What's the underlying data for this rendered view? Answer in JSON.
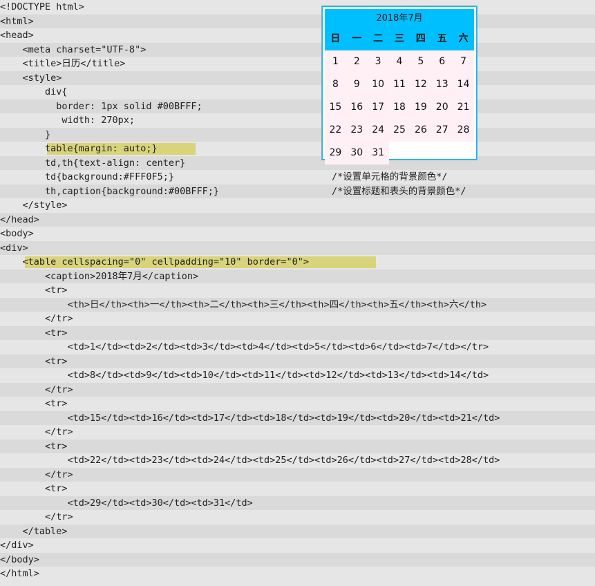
{
  "code_lines": [
    {
      "text": "<!DOCTYPE html>"
    },
    {
      "text": "<html>"
    },
    {
      "text": "<head>"
    },
    {
      "text": "    <meta charset=\"UTF-8\">"
    },
    {
      "text": "    <title>日历</title>"
    },
    {
      "text": "    <style>"
    },
    {
      "text": "        div{"
    },
    {
      "text": "          border: 1px solid #00BFFF;"
    },
    {
      "text": "           width: 270px;"
    },
    {
      "text": "        }"
    },
    {
      "text": "        table{margin: auto;}",
      "highlight": true
    },
    {
      "text": "        td,th{text-align: center}"
    },
    {
      "text": "        td{background:#FFF0F5;}",
      "comment": "/*设置单元格的背景颜色*/"
    },
    {
      "text": "        th,caption{background:#00BFFF;}",
      "comment": "/*设置标题和表头的背景颜色*/"
    },
    {
      "text": "    </style>"
    },
    {
      "text": "</head>"
    },
    {
      "text": "<body>"
    },
    {
      "text": "<div>"
    },
    {
      "text": "    <table cellspacing=\"0\" cellpadding=\"10\" border=\"0\">",
      "highlight": true
    },
    {
      "text": "        <caption>2018年7月</caption>"
    },
    {
      "text": "        <tr>"
    },
    {
      "text": "            <th>日</th><th>一</th><th>二</th><th>三</th><th>四</th><th>五</th><th>六</th>"
    },
    {
      "text": "        </tr>"
    },
    {
      "text": "        <tr>"
    },
    {
      "text": "            <td>1</td><td>2</td><td>3</td><td>4</td><td>5</td><td>6</td><td>7</td></tr>"
    },
    {
      "text": "        <tr>"
    },
    {
      "text": "            <td>8</td><td>9</td><td>10</td><td>11</td><td>12</td><td>13</td><td>14</td>"
    },
    {
      "text": "        </tr>"
    },
    {
      "text": "        <tr>"
    },
    {
      "text": "            <td>15</td><td>16</td><td>17</td><td>18</td><td>19</td><td>20</td><td>21</td>"
    },
    {
      "text": "        </tr>"
    },
    {
      "text": "        <tr>"
    },
    {
      "text": "            <td>22</td><td>23</td><td>24</td><td>25</td><td>26</td><td>27</td><td>28</td>"
    },
    {
      "text": "        </tr>"
    },
    {
      "text": "        <tr>"
    },
    {
      "text": "            <td>29</td><td>30</td><td>31</td>"
    },
    {
      "text": "        </tr>"
    },
    {
      "text": "    </table>"
    },
    {
      "text": "</div>"
    },
    {
      "text": "</body>"
    },
    {
      "text": "</html>"
    }
  ],
  "calendar": {
    "caption": "2018年7月",
    "weekdays": [
      "日",
      "一",
      "二",
      "三",
      "四",
      "五",
      "六"
    ],
    "days": [
      "1",
      "2",
      "3",
      "4",
      "5",
      "6",
      "7",
      "8",
      "9",
      "10",
      "11",
      "12",
      "13",
      "14",
      "15",
      "16",
      "17",
      "18",
      "19",
      "20",
      "21",
      "22",
      "23",
      "24",
      "25",
      "26",
      "27",
      "28",
      "29",
      "30",
      "31"
    ],
    "colors": {
      "header_bg": "#00BFFF",
      "cell_bg": "#FFF0F5",
      "border": "#00BFFF"
    }
  },
  "colors": {
    "highlight": "#d9d47a",
    "page_bg": "#e6e6e6"
  }
}
